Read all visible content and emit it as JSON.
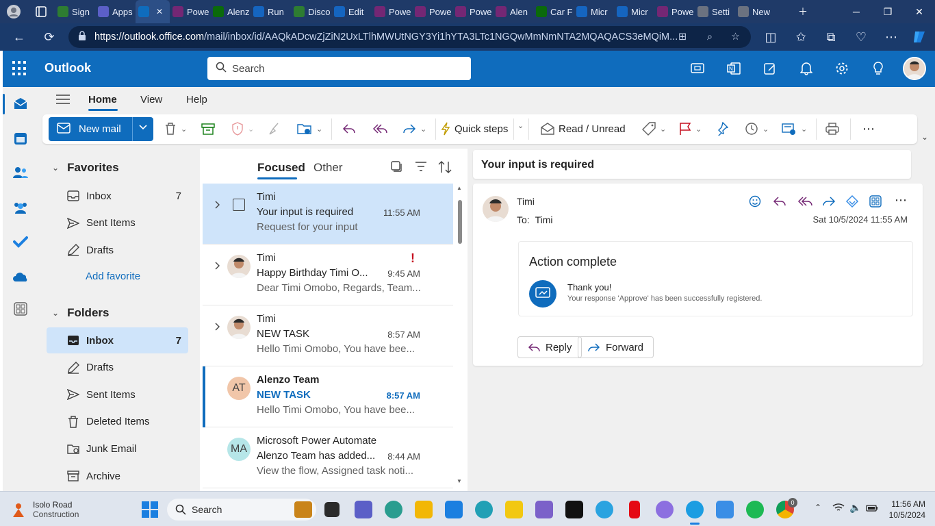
{
  "browser": {
    "tabs": [
      {
        "label": "Sign",
        "color": "#2e7d32"
      },
      {
        "label": "Apps",
        "color": "#5b5fc7"
      },
      {
        "label": "",
        "color": "#0f6cbd",
        "active": true
      },
      {
        "label": "Powe",
        "color": "#742774"
      },
      {
        "label": "Alenz",
        "color": "#0b6a0b"
      },
      {
        "label": "Run",
        "color": "#1565c0"
      },
      {
        "label": "Disco",
        "color": "#2e7d32"
      },
      {
        "label": "Edit",
        "color": "#1565c0"
      },
      {
        "label": "Powe",
        "color": "#742774"
      },
      {
        "label": "Powe",
        "color": "#742774"
      },
      {
        "label": "Powe",
        "color": "#742774"
      },
      {
        "label": "Alen",
        "color": "#742774"
      },
      {
        "label": "Car F",
        "color": "#0b6a0b"
      },
      {
        "label": "Micr",
        "color": "#1565c0"
      },
      {
        "label": "Micr",
        "color": "#1565c0"
      },
      {
        "label": "Powe",
        "color": "#742774"
      },
      {
        "label": "Setti",
        "color": "#6b7280"
      },
      {
        "label": "New",
        "color": "#6b7280"
      }
    ],
    "url_domain": "https://outlook.office.com",
    "url_path": "/mail/inbox/id/AAQkADcwZjZiN2UxLTlhMWUtNGY3Yi1hYTA3LTc1NGQwMmNmNTA2MQAQACS3eMQiM..."
  },
  "app": {
    "title": "Outlook",
    "search_placeholder": "Search"
  },
  "ribbon": {
    "tabs": [
      "Home",
      "View",
      "Help"
    ],
    "new_mail": "New mail",
    "quick_steps": "Quick steps",
    "read_unread": "Read / Unread"
  },
  "folders": {
    "favorites_header": "Favorites",
    "favorites": [
      {
        "label": "Inbox",
        "count": "7",
        "icon": "inbox-icon"
      },
      {
        "label": "Sent Items",
        "count": "",
        "icon": "send-icon"
      },
      {
        "label": "Drafts",
        "count": "",
        "icon": "draft-icon"
      }
    ],
    "add_favorite": "Add favorite",
    "folders_header": "Folders",
    "items": [
      {
        "label": "Inbox",
        "count": "7",
        "icon": "inbox-icon",
        "selected": true
      },
      {
        "label": "Drafts",
        "count": "",
        "icon": "draft-icon"
      },
      {
        "label": "Sent Items",
        "count": "",
        "icon": "send-icon"
      },
      {
        "label": "Deleted Items",
        "count": "",
        "icon": "trash-icon"
      },
      {
        "label": "Junk Email",
        "count": "",
        "icon": "junk-icon"
      },
      {
        "label": "Archive",
        "count": "",
        "icon": "archive-icon"
      }
    ]
  },
  "message_list": {
    "tab_focused": "Focused",
    "tab_other": "Other",
    "messages": [
      {
        "from": "Timi",
        "subject": "Your input is required",
        "time": "11:55 AM",
        "preview": "Request for your input",
        "selected": true,
        "unread": false,
        "avatar": "checkbox"
      },
      {
        "from": "Timi",
        "subject": "Happy Birthday Timi O...",
        "time": "9:45 AM",
        "preview": "Dear Timi Omobo, Regards, Team...",
        "important": true,
        "avatar": "photo"
      },
      {
        "from": "Timi",
        "subject": "NEW TASK",
        "time": "8:57 AM",
        "preview": "Hello Timi Omobo, You have bee...",
        "avatar": "photo"
      },
      {
        "from": "Alenzo Team",
        "subject": "NEW TASK",
        "time": "8:57 AM",
        "preview": "Hello Timi Omobo, You have bee...",
        "unread": true,
        "avatar": "AT",
        "avatar_color": "#f1c6a9"
      },
      {
        "from": "Microsoft Power Automate",
        "subject": "Alenzo Team has added...",
        "time": "8:44 AM",
        "preview": "View the flow, Assigned task noti...",
        "avatar": "MA",
        "avatar_color": "#b6e6e8"
      }
    ]
  },
  "reading_pane": {
    "subject": "Your input is required",
    "from": "Timi",
    "to_label": "To:",
    "to": "Timi",
    "date": "Sat 10/5/2024 11:55 AM",
    "card_title": "Action complete",
    "card_heading": "Thank you!",
    "card_text": "Your response 'Approve' has been successfully registered.",
    "reply": "Reply",
    "forward": "Forward"
  },
  "taskbar": {
    "weather_title": "Isolo Road",
    "weather_sub": "Construction",
    "search": "Search",
    "time": "11:56 AM",
    "date": "10/5/2024",
    "chrome_badge": "0"
  }
}
